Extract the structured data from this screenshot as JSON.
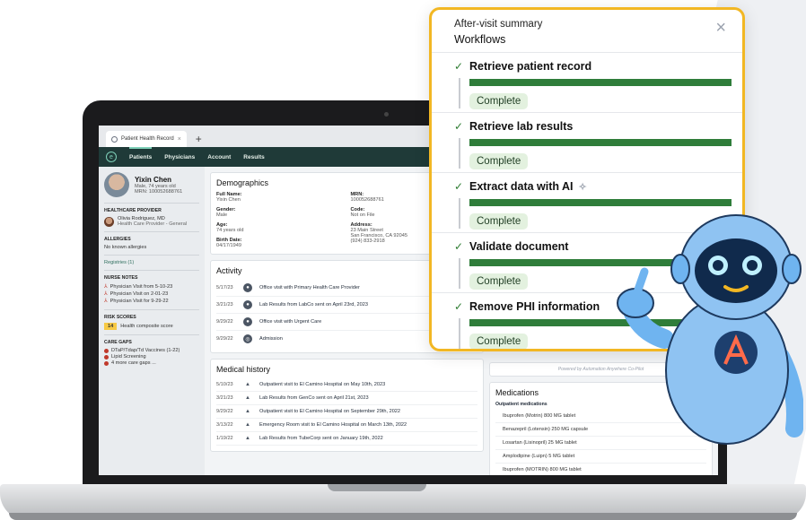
{
  "browser": {
    "tab_label": "Patient Health Record",
    "tab_close": "×",
    "new_tab": "+"
  },
  "nav": {
    "items": [
      {
        "label": "Patients",
        "active": true
      },
      {
        "label": "Physicians",
        "active": false
      },
      {
        "label": "Account",
        "active": false
      },
      {
        "label": "Results",
        "active": false
      }
    ]
  },
  "patient": {
    "name": "Yixin Chen",
    "summary": "Male, 74 years old",
    "mrn_line": "MRN: 100052688761"
  },
  "sidebar": {
    "provider_title": "HEALTHCARE PROVIDER",
    "provider_name": "Olivia Rodriguez, MD",
    "provider_role": "Health Care Provider - General",
    "allergies_title": "ALLERGIES",
    "allergies_value": "No known allergies",
    "registries": "Registries (1)",
    "nurse_notes_title": "NURSE NOTES",
    "nurse_notes": [
      "Physician Visit from 5-10-23",
      "Physician Visit on 2-01-23",
      "Physician Visit for 9-29-22"
    ],
    "risk_title": "RISK SCORES",
    "risk_value": "14",
    "risk_label": "Health composite score",
    "care_gaps_title": "CARE GAPS",
    "care_gaps": [
      "DTaP/Tdap/Td Vaccines (1-22)",
      "Lipid Screening",
      "4 more care gaps ..."
    ]
  },
  "demographics": {
    "title": "Demographics",
    "fields": [
      {
        "label": "Full Name:",
        "value": "Yixin Chen"
      },
      {
        "label": "MRN:",
        "value": "100052688761"
      },
      {
        "label": "Gender:",
        "value": "Male"
      },
      {
        "label": "Code:",
        "value": "Not on File"
      },
      {
        "label": "Age:",
        "value": "74 years old"
      },
      {
        "label": "Address:",
        "value": "23 Main Street\nSan Francisco, CA 92045\n(924) 833-2918"
      },
      {
        "label": "Birth Date:",
        "value": "04/17/1949"
      }
    ]
  },
  "activity": {
    "title": "Activity",
    "rows": [
      {
        "date": "5/17/23",
        "icon": "person-icon",
        "text": "Office visit with Primary Health Care Provider"
      },
      {
        "date": "3/21/23",
        "icon": "person-icon",
        "text": "Lab Results from LabCo sent on April 23rd, 2023"
      },
      {
        "date": "9/29/22",
        "icon": "person-icon",
        "text": "Office visit with Urgent Care"
      },
      {
        "date": "9/29/22",
        "icon": "admission-icon",
        "text": "Admission"
      }
    ]
  },
  "medical_history": {
    "title": "Medical history",
    "rows": [
      {
        "date": "5/10/23",
        "text": "Outpatient visit to El Camino Hospital on May 10th, 2023"
      },
      {
        "date": "3/21/23",
        "text": "Lab Results from GenCo sent on April 21st, 2023"
      },
      {
        "date": "9/29/22",
        "text": "Outpatient visit to El Camino Hospital on September 29th, 2022"
      },
      {
        "date": "3/13/22",
        "text": "Emergency Room visit to El Camino Hospital on March 13th, 2022"
      },
      {
        "date": "1/19/22",
        "text": "Lab Results from TubeCorp sent on January 19th, 2022"
      }
    ]
  },
  "powered_by": "Powered by Automation Anywhere Co-Pilot",
  "medications": {
    "title": "Medications",
    "subtitle": "Outpatient medications",
    "items": [
      "Ibuprofen (Motrin) 800 MG tablet",
      "Benazepril (Lotensin) 250 MG capsule",
      "Losartan (Lisinopril) 25 MG tablet",
      "Amplodipine (Luipn) 5 MG tablet",
      "Ibuprofen (MOTRIN) 800 MG tablet"
    ]
  },
  "workflow": {
    "subtitle": "After-visit summary",
    "title": "Workflows",
    "close": "×",
    "steps": [
      {
        "name": "Retrieve patient record",
        "status": "Complete",
        "progress": 1.0,
        "ai": false
      },
      {
        "name": "Retrieve lab results",
        "status": "Complete",
        "progress": 1.0,
        "ai": false
      },
      {
        "name": "Extract data with AI",
        "status": "Complete",
        "progress": 1.0,
        "ai": true
      },
      {
        "name": "Validate document",
        "status": "Complete",
        "progress": 1.0,
        "ai": false
      },
      {
        "name": "Remove PHI information",
        "status": "Complete",
        "progress": 1.0,
        "ai": false
      }
    ]
  },
  "colors": {
    "accent": "#f2b723",
    "progress": "#2f7d3a",
    "navbar": "#1f3a38"
  }
}
